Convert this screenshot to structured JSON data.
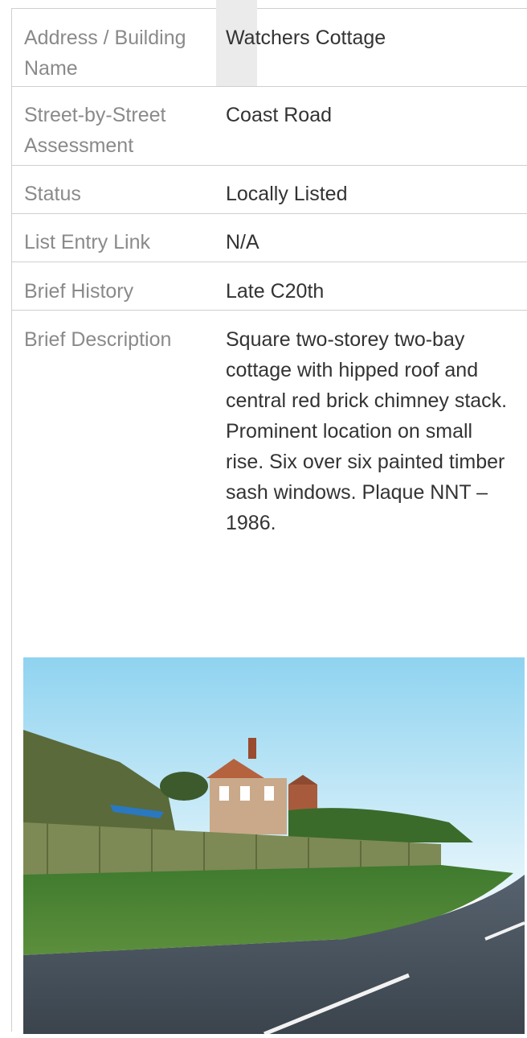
{
  "rows": [
    {
      "label": "Address / Building Name",
      "value": "Watchers Cottage"
    },
    {
      "label": "Street-by-Street Assessment",
      "value": "Coast Road"
    },
    {
      "label": "Status",
      "value": "Locally Listed"
    },
    {
      "label": "List Entry Link",
      "value": "N/A"
    },
    {
      "label": "Brief History",
      "value": "Late C20th"
    },
    {
      "label": "Brief Description",
      "value": "Square two-storey two-bay cottage with hipped roof and central red brick chimney stack. Prominent location on small rise. Six over six painted timber sash windows. Plaque NNT – 1986."
    }
  ],
  "colors": {
    "label": "#8a8a8a",
    "value": "#333333",
    "border": "#cfcfcf"
  }
}
